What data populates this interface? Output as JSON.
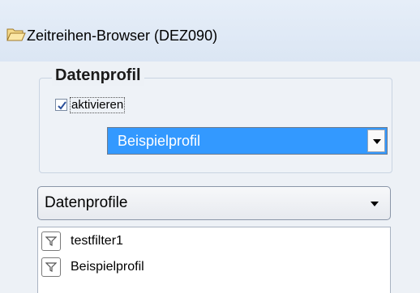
{
  "window": {
    "title": "Zeitreihen-Browser (DEZ090)",
    "icon": "folder-open-icon"
  },
  "datenprofil_group": {
    "legend": "Datenprofil",
    "activate_checkbox": {
      "label": "aktivieren",
      "checked": true
    },
    "profile_select": {
      "selected": "Beispielprofil"
    }
  },
  "profiles_dropdown": {
    "label": "Datenprofile"
  },
  "filter_list": {
    "items": [
      {
        "label": "testfilter1",
        "icon": "filter-icon"
      },
      {
        "label": "Beispielprofil",
        "icon": "filter-icon"
      }
    ]
  },
  "colors": {
    "selection": "#3399ff",
    "panel": "#edf1f6",
    "titlebar": "#dbe6f4"
  }
}
